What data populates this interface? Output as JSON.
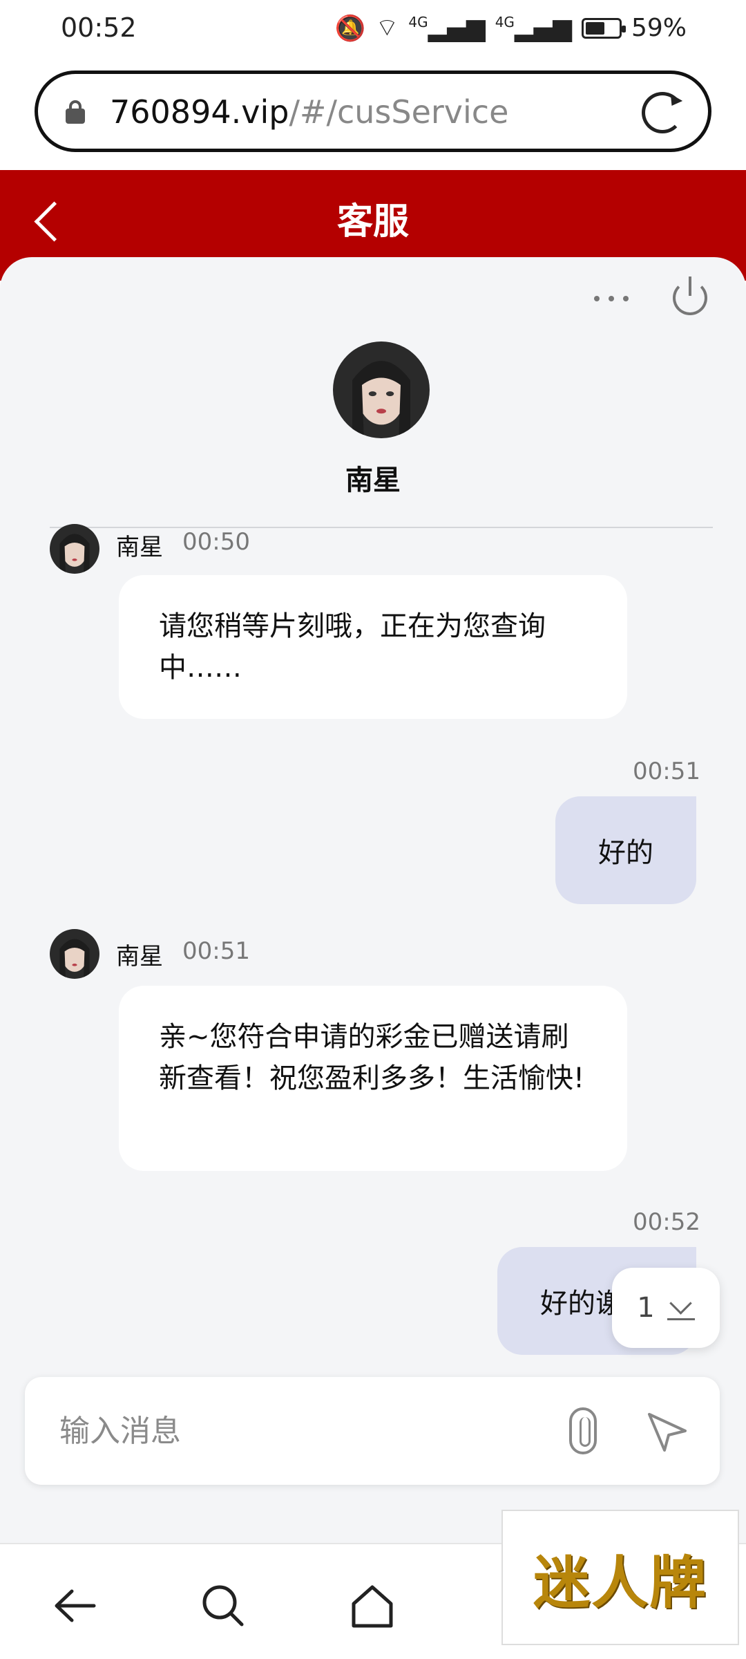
{
  "status_bar": {
    "time": "00:52",
    "signal_1": "4G",
    "signal_2": "4G",
    "battery": "59%",
    "battery_level": 0.59
  },
  "browser": {
    "url_host": "760894.vip",
    "url_path": "/#/cusService"
  },
  "header": {
    "title": "客服"
  },
  "agent": {
    "name": "南星"
  },
  "messages": [
    {
      "from": "agent",
      "name": "南星",
      "time": "00:50",
      "text": "请您稍等片刻哦，正在为您查询中……"
    },
    {
      "from": "user",
      "time": "00:51",
      "text": "好的"
    },
    {
      "from": "agent",
      "name": "南星",
      "time": "00:51",
      "text": "亲~您符合申请的彩金已赠送请刷新查看！祝您盈利多多！生活愉快!"
    },
    {
      "from": "user",
      "time": "00:52",
      "text": "好的谢"
    }
  ],
  "unread": {
    "count": "1"
  },
  "composer": {
    "placeholder": "输入消息"
  },
  "watermark": {
    "text": "迷人牌"
  },
  "colors": {
    "header_red": "#b40000",
    "outgoing_bubble": "#dcdff0",
    "panel_bg": "#f4f5f7"
  }
}
